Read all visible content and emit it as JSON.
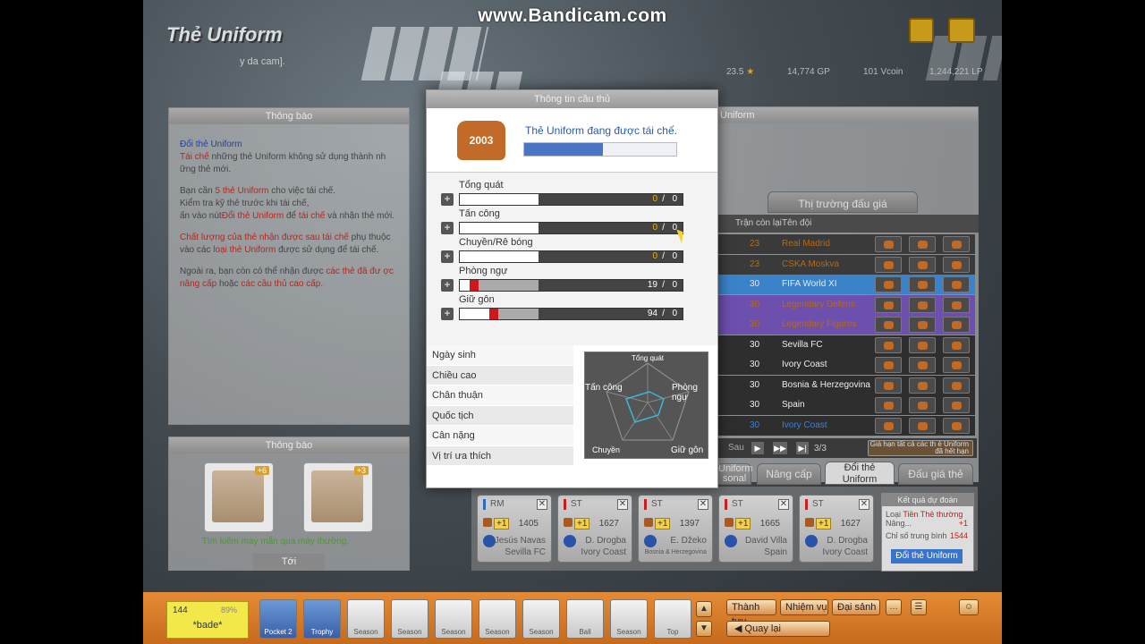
{
  "watermark": "www.Bandicam.com",
  "header": {
    "title": "Thẻ Uniform",
    "subtitle": "y da cam].",
    "resources": [
      {
        "name": "level",
        "value": "23.5"
      },
      {
        "name": "gp",
        "value": "14,774 GP"
      },
      {
        "name": "vcoin",
        "value": "101 Vcoin"
      },
      {
        "name": "lp",
        "value": "1,244,221 LP"
      }
    ]
  },
  "notice": {
    "title": "Thông báo",
    "heading": "Đổi thẻ Uniform",
    "l1a": "Tái chế",
    "l1b": "những thẻ Uniform không sử dụng thành nh ững thẻ mới.",
    "l2a": "Bạn cần",
    "l2b": "5 thẻ Uniform",
    "l2c": "cho việc tái chế.",
    "l2d": "Kiểm tra kỹ thẻ trước khi tái chế,",
    "l2e": "ấn vào nút",
    "l2f": "Đổi thẻ Uniform",
    "l2g": "để",
    "l2h": "tái chế",
    "l2i": "và nhận thẻ mới.",
    "l3a": "Chất lượng của thẻ nhận được sau tái chế",
    "l3b": "phụ thuộc vào các",
    "l3c": "loại thẻ Uniform",
    "l3d": "được sử dụng để tái chế.",
    "l4a": "Ngoài ra, bạn còn có thể nhận được",
    "l4b": "các thẻ đã đư ợc nâng cấp",
    "l4c": "hoặc",
    "l4d": "các cầu thủ cao cấp."
  },
  "lucky": {
    "title": "Thông báo",
    "cards": [
      {
        "bonus": "+6"
      },
      {
        "bonus": "+3"
      }
    ],
    "hint": "Tìm kiếm may mắn qua máy thường.",
    "next_label": "Tới"
  },
  "dialog": {
    "title": "Thông tin cầu thủ",
    "jersey_label": "2003",
    "message": "Thẻ Uniform đang được tái chế.",
    "progress": 0.52,
    "stats": [
      {
        "label": "Tổng quát",
        "value": 0,
        "max": 0
      },
      {
        "label": "Tấn công",
        "value": 0,
        "max": 0
      },
      {
        "label": "Chuyền/Rê bóng",
        "value": 0,
        "max": 0
      },
      {
        "label": "Phòng ngự",
        "value": 19,
        "max": 0
      },
      {
        "label": "Giữ gôn",
        "value": 94,
        "max": 0
      }
    ],
    "info_rows": [
      "Ngày sinh",
      "Chiều cao",
      "Chân thuận",
      "Quốc tịch",
      "Cân nặng",
      "Vị trí ưa thích"
    ],
    "radar": [
      "Tổng quát",
      "Tấn công",
      "Phòng ngự",
      "Chuyền",
      "Giữ gôn"
    ]
  },
  "right": {
    "title": "Uniform",
    "market_tab": "Thị trường đấu giá",
    "headers": [
      "Trận còn lại",
      "Tên đội"
    ],
    "rows": [
      {
        "n": "23",
        "team": "Real Madrid",
        "color": "#b46a18",
        "bg": "#3a3a3a"
      },
      {
        "n": "23",
        "team": "CSKA Moskva",
        "color": "#b46a18",
        "bg": "#3a3a3a"
      },
      {
        "n": "30",
        "team": "FIFA World XI",
        "color": "#dfe8ff",
        "bg": "#3b83c8"
      },
      {
        "n": "30",
        "team": "Legendary Defens",
        "color": "#b46a18",
        "bg": "#6d4fae"
      },
      {
        "n": "30",
        "team": "Legendary Figures",
        "color": "#b46a18",
        "bg": "#6d4fae"
      },
      {
        "n": "30",
        "team": "Sevilla FC",
        "color": "#eeeeee",
        "bg": "#2e2e2e"
      },
      {
        "n": "30",
        "team": "Ivory Coast",
        "color": "#eeeeee",
        "bg": "#2e2e2e"
      },
      {
        "n": "30",
        "team": "Bosnia & Herzegovina",
        "color": "#eeeeee",
        "bg": "#2e2e2e"
      },
      {
        "n": "30",
        "team": "Spain",
        "color": "#eeeeee",
        "bg": "#2e2e2e"
      },
      {
        "n": "30",
        "team": "Ivory Coast",
        "color": "#3b7fd0",
        "bg": "#2e2e2e"
      }
    ],
    "page_next_label": "Sau",
    "page_info": "3/3",
    "expired_note": "Giá hạn tất cả các th ẻ Uniform đã hết hạn",
    "bottom_tabs": [
      "Uniform sonal",
      "Nâng cấp",
      "Đổi thẻ Uniform",
      "Đấu giá thẻ"
    ]
  },
  "exchange_cards": [
    {
      "pos": "RM",
      "pos_color": "#2b6cc8",
      "plus": "+1",
      "ovr": "1405",
      "name": "Jesús Navas",
      "club": "Sevilla FC"
    },
    {
      "pos": "ST",
      "pos_color": "#c82020",
      "plus": "+1",
      "ovr": "1627",
      "name": "D. Drogba",
      "club": "Ivory Coast"
    },
    {
      "pos": "ST",
      "pos_color": "#c82020",
      "plus": "+1",
      "ovr": "1397",
      "name": "E. Džeko",
      "club": "Bosnia & Herzegovina"
    },
    {
      "pos": "ST",
      "pos_color": "#c82020",
      "plus": "+1",
      "ovr": "1665",
      "name": "David Villa",
      "club": "Spain"
    },
    {
      "pos": "ST",
      "pos_color": "#c82020",
      "plus": "+1",
      "ovr": "1627",
      "name": "D. Drogba",
      "club": "Ivory Coast"
    }
  ],
  "result": {
    "title": "Kết quả dự đoán",
    "type_label": "Loại",
    "type_value": "Tiền Thẻ thường",
    "l2_label": "Nâng...",
    "l2_value": "+1",
    "l3_label": "Chỉ số trung bình",
    "l3_value": "1544",
    "button": "Đổi thẻ Uniform"
  },
  "bottom": {
    "user_level": "144",
    "user_pct": "89%",
    "user_name": "*bade*",
    "slots": [
      "Pocket 2",
      "Trophy",
      "Season",
      "Season",
      "Season",
      "Season",
      "Season",
      "Ball",
      "Season",
      "Top"
    ],
    "buttons": [
      "Thành tựu",
      "Nhiệm vụ",
      "Đại sảnh"
    ],
    "back": "Quay lại"
  }
}
